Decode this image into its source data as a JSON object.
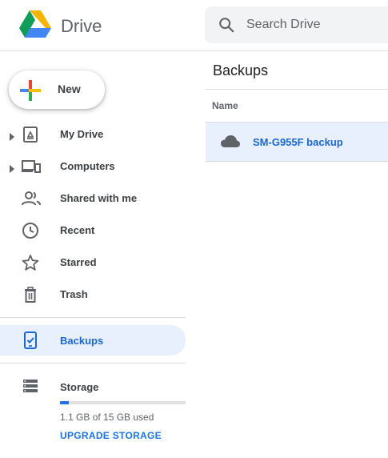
{
  "header": {
    "brand": "Drive",
    "search": {
      "placeholder": "Search Drive",
      "value": ""
    }
  },
  "sidebar": {
    "new_label": "New",
    "items": [
      {
        "label": "My Drive",
        "icon": "my-drive-icon",
        "expandable": true
      },
      {
        "label": "Computers",
        "icon": "computers-icon",
        "expandable": true
      },
      {
        "label": "Shared with me",
        "icon": "shared-icon",
        "expandable": false
      },
      {
        "label": "Recent",
        "icon": "clock-icon",
        "expandable": false
      },
      {
        "label": "Starred",
        "icon": "star-icon",
        "expandable": false
      },
      {
        "label": "Trash",
        "icon": "trash-icon",
        "expandable": false
      },
      {
        "label": "Backups",
        "icon": "backup-icon",
        "expandable": false,
        "active": true
      }
    ],
    "storage": {
      "label": "Storage",
      "usage_text": "1.1 GB of 15 GB used",
      "used_fraction": 0.073,
      "upgrade_label": "UPGRADE STORAGE"
    }
  },
  "main": {
    "title": "Backups",
    "columns": [
      "Name"
    ],
    "rows": [
      {
        "name": "SM-G955F backup",
        "icon": "cloud-icon",
        "selected": true
      }
    ]
  },
  "colors": {
    "accent": "#1a73e8",
    "active_bg": "#e8f0fe",
    "active_text": "#1967d2",
    "divider": "#dadce0",
    "icon_gray": "#5f6368"
  }
}
